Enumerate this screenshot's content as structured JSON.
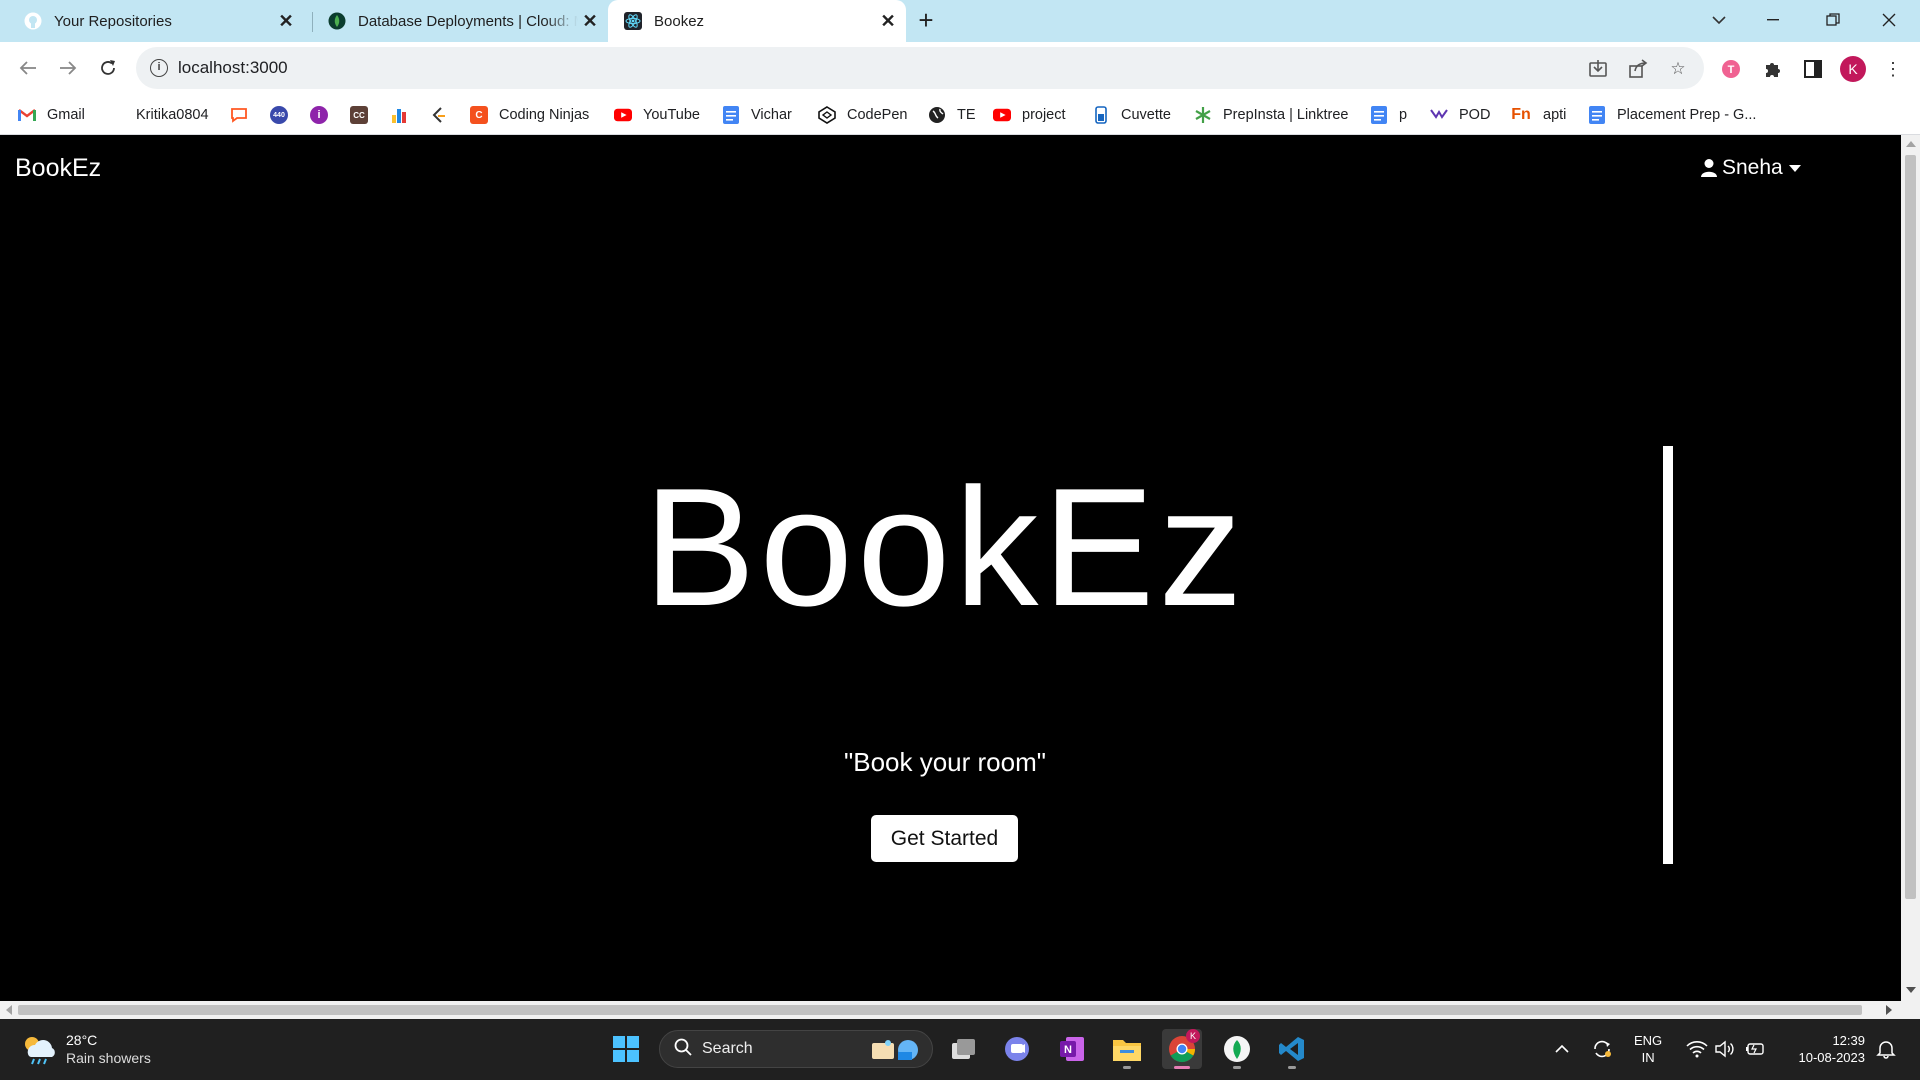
{
  "browser": {
    "tabs": [
      {
        "title": "Your Repositories",
        "icon": "github-icon"
      },
      {
        "title": "Database Deployments | Cloud: MongoDB Cloud",
        "icon": "mongodb-leaf-icon"
      },
      {
        "title": "Bookez",
        "icon": "react-icon"
      }
    ],
    "url": "localhost:3000",
    "profile_initial": "K"
  },
  "bookmarks": [
    {
      "label": "Gmail",
      "icon": "gmail-icon",
      "color": "#ea4335"
    },
    {
      "label": "Kritika0804",
      "icon": "",
      "color": ""
    },
    {
      "label": "",
      "icon": "chat-bubble-icon",
      "color": "#ff5722"
    },
    {
      "label": "",
      "icon": "badge-440-icon",
      "color": "#3f51b5"
    },
    {
      "label": "",
      "icon": "purple-circle-icon",
      "color": "#8e24aa"
    },
    {
      "label": "",
      "icon": "cc-icon",
      "color": "#5d4037"
    },
    {
      "label": "",
      "icon": "bar-chart-icon",
      "color": "#1e88e5"
    },
    {
      "label": "",
      "icon": "leetcode-icon",
      "color": "#333333"
    },
    {
      "label": "Coding Ninjas",
      "icon": "coding-ninjas-icon",
      "color": "#f4511e"
    },
    {
      "label": "YouTube",
      "icon": "youtube-icon",
      "color": "#ff0000"
    },
    {
      "label": "Vichar",
      "icon": "docs-icon",
      "color": "#4285f4"
    },
    {
      "label": "CodePen",
      "icon": "codepen-icon",
      "color": "#111111"
    },
    {
      "label": "TE",
      "icon": "globe-icon",
      "color": "#222222"
    },
    {
      "label": "project",
      "icon": "youtube-icon",
      "color": "#ff0000"
    },
    {
      "label": "Cuvette",
      "icon": "cuvette-icon",
      "color": "#1565c0"
    },
    {
      "label": "PrepInsta | Linktree",
      "icon": "linktree-icon",
      "color": "#43a047"
    },
    {
      "label": "p",
      "icon": "docs-icon",
      "color": "#4285f4"
    },
    {
      "label": "POD",
      "icon": "pod-icon",
      "color": "#5e35b1"
    },
    {
      "label": "apti",
      "icon": "fn-icon",
      "color": "#e65100"
    },
    {
      "label": "Placement Prep - G...",
      "icon": "docs-icon",
      "color": "#4285f4"
    }
  ],
  "page": {
    "brand": "BookEz",
    "user": "Sneha",
    "hero_title": "BookEz",
    "tagline": "\"Book your room\"",
    "cta": "Get Started"
  },
  "taskbar": {
    "weather_temp": "28°C",
    "weather_condition": "Rain showers",
    "search_label": "Search",
    "lang_line1": "ENG",
    "lang_line2": "IN",
    "time": "12:39",
    "date": "10-08-2023",
    "chrome_badge": "K"
  }
}
